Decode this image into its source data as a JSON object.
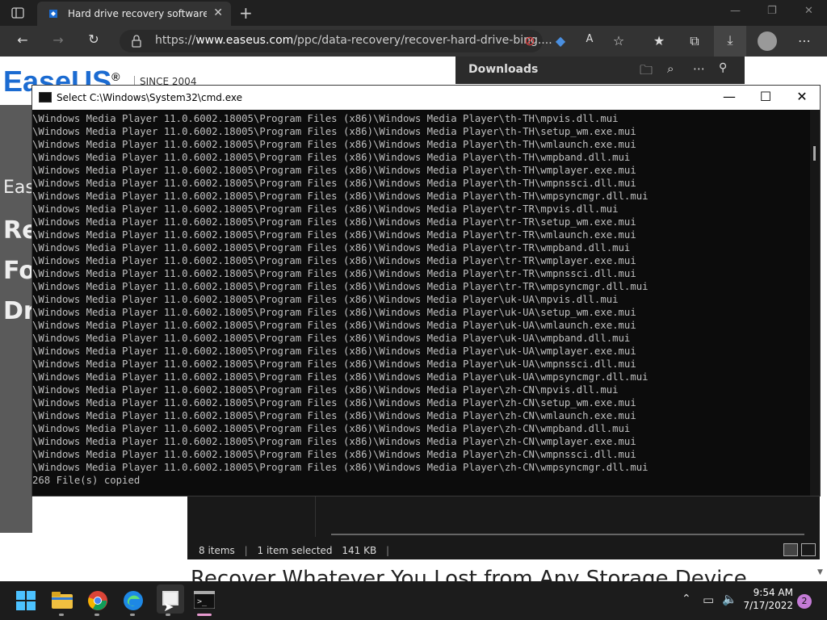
{
  "browser": {
    "tab_title": "Hard drive recovery software: re",
    "url_prefix": "https://",
    "url_domain": "www.easeus.com",
    "url_path": "/ppc/data-recovery/recover-hard-drive-bing....",
    "colors": {
      "tab_icon": "#1b6bd1"
    }
  },
  "page": {
    "logo_text": "EaseUS",
    "logo_reg": "®",
    "since": "SINCE 2004",
    "heading_fragments": [
      "Eas",
      "Re",
      "Fo",
      "Dr"
    ],
    "bottom_heading": "Recover Whatever You Lost from Any Storage Device"
  },
  "downloads": {
    "title": "Downloads"
  },
  "explorer": {
    "items": "8 items",
    "selected": "1 item selected",
    "size": "141 KB"
  },
  "cmd": {
    "title": "Select C:\\Windows\\System32\\cmd.exe",
    "prefix": "\\Windows Media Player 11.0.6002.18005\\Program Files (x86)\\Windows Media Player\\",
    "lines": [
      "th-TH\\mpvis.dll.mui",
      "th-TH\\setup_wm.exe.mui",
      "th-TH\\wmlaunch.exe.mui",
      "th-TH\\wmpband.dll.mui",
      "th-TH\\wmplayer.exe.mui",
      "th-TH\\wmpnssci.dll.mui",
      "th-TH\\wmpsyncmgr.dll.mui",
      "tr-TR\\mpvis.dll.mui",
      "tr-TR\\setup_wm.exe.mui",
      "tr-TR\\wmlaunch.exe.mui",
      "tr-TR\\wmpband.dll.mui",
      "tr-TR\\wmplayer.exe.mui",
      "tr-TR\\wmpnssci.dll.mui",
      "tr-TR\\wmpsyncmgr.dll.mui",
      "uk-UA\\mpvis.dll.mui",
      "uk-UA\\setup_wm.exe.mui",
      "uk-UA\\wmlaunch.exe.mui",
      "uk-UA\\wmpband.dll.mui",
      "uk-UA\\wmplayer.exe.mui",
      "uk-UA\\wmpnssci.dll.mui",
      "uk-UA\\wmpsyncmgr.dll.mui",
      "zh-CN\\mpvis.dll.mui",
      "zh-CN\\setup_wm.exe.mui",
      "zh-CN\\wmlaunch.exe.mui",
      "zh-CN\\wmpband.dll.mui",
      "zh-CN\\wmplayer.exe.mui",
      "zh-CN\\wmpnssci.dll.mui",
      "zh-CN\\wmpsyncmgr.dll.mui"
    ],
    "summary": "268 File(s) copied"
  },
  "taskbar": {
    "time": "9:54 AM",
    "date": "7/17/2022",
    "notification_count": "2",
    "icons": [
      "windows-start-icon",
      "file-explorer-icon",
      "chrome-icon",
      "edge-icon",
      "app-icon",
      "terminal-icon"
    ]
  }
}
